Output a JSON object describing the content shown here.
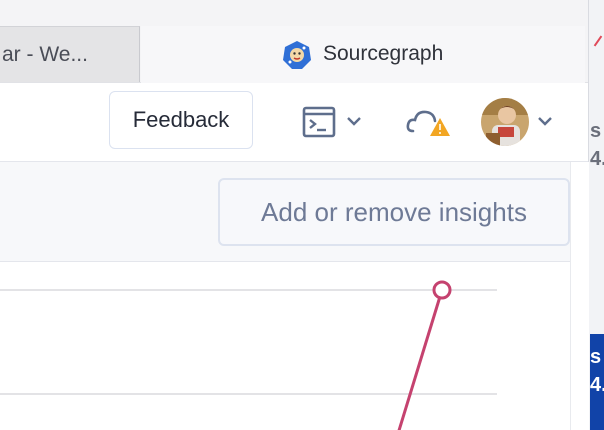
{
  "browser": {
    "inactive_tab_title": "ar - We...",
    "active_tab_title": "Sourcegraph"
  },
  "navbar": {
    "feedback_label": "Feedback",
    "terminal_icon": "terminal-icon",
    "cloud_warning_icon": "cloud-warning-icon",
    "avatar_icon": "user-avatar"
  },
  "header": {
    "add_remove_label": "Add or remove insights"
  },
  "sidebar_sliver": {
    "line1": "s",
    "line2": "4.",
    "line3": "s",
    "line4": "4."
  },
  "colors": {
    "series": "#c5426f",
    "gridline": "#e3e3e6",
    "accent_warning": "#f2a623",
    "icon_slate": "#5e6e8c"
  }
}
